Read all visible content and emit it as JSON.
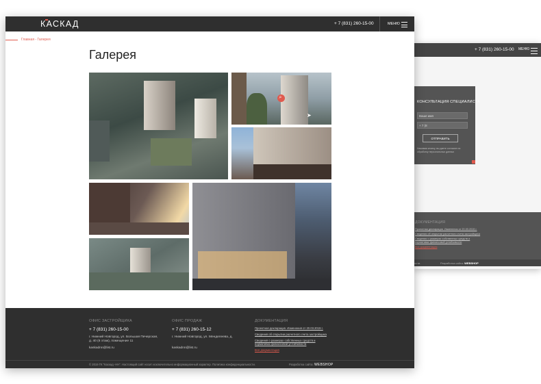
{
  "header": {
    "logo": "КАСКАД",
    "phone": "+ 7 (831) 260-15-00",
    "menu_label": "МЕНЮ"
  },
  "breadcrumb": "Главная - Галерея",
  "page_title": "Галерея",
  "gallery": {
    "photos": [
      "aerial-view",
      "entrance-view",
      "facade-view",
      "terrace-view",
      "street-night-view",
      "district-aerial-view"
    ]
  },
  "footer": {
    "office_dev": {
      "title": "ОФИС ЗАСТРОЙЩИКА",
      "phone": "+ 7 (831) 260-15-00",
      "address_line1": "г. Нижний Новгород, ул. Большая Печерская,",
      "address_line2": "д. 40 (6 этаж), помещение 11",
      "email": "kaskadnn@list.ru"
    },
    "office_sales": {
      "title": "ОФИС ПРОДАЖ",
      "phone": "+ 7 (831) 260-15-12",
      "address": "г. Нижний Новгород, ул. Менделеева, д.",
      "email": "kaskadnn@list.ru"
    },
    "documents": {
      "title": "ДОКУМЕНТАЦИЯ",
      "links": [
        "Проектная декларация. Изменения от 20.03.2019 г.",
        "Сведения об открытии расчетного счета застройщика",
        "Сведения о размерах собственных средств и",
        "нормативах финансовой устойчивости"
      ],
      "all_link": "Вся документация"
    },
    "copyright": "© 2019 ГК \"Каскад -НН\". Настоящий сайт носит исключительно информационный характер. Политика конфиденциальности.",
    "dev_label": "Разработка сайта:",
    "dev_name": "WEBSHOP"
  },
  "back_mock": {
    "phone": "+ 7 (831) 260-15-00",
    "menu_label": "МЕНЮ",
    "consult_title": "КОНСУЛЬТАЦИЯ СПЕЦИАЛИСТА",
    "name_placeholder": "Ваше имя",
    "phone_placeholder": "+ 7 (8",
    "submit_label": "ОТПРАВИТЬ",
    "note": "Нажимая кнопку, вы даете согласие на обработку персональных данных",
    "docs_title": "ДОКУМЕНТАЦИЯ",
    "doc_links": [
      "Проектная декларация. Изменения от 20.03.2019 г.",
      "Сведения об открытии расчетного счета застройщика",
      "Сведения о размерах собственных средств и",
      "нормативах финансовой устойчивости"
    ],
    "all_docs": "Вся документация",
    "bottom_left": "ости.",
    "dev_label": "Разработка сайта:",
    "dev_name": "WEBSHOP"
  }
}
